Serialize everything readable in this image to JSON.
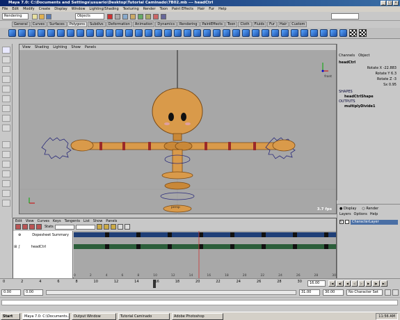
{
  "window": {
    "title": "Maya 7.0: C:\\Documents and Settings\\usuario\\Desktop\\Tutorial Caminado\\7B02.mb  ---  headCtrl"
  },
  "menu": [
    "File",
    "Edit",
    "Modify",
    "Create",
    "Display",
    "Window",
    "Lighting/Shading",
    "Texturing",
    "Render",
    "Toon",
    "Paint Effects",
    "Hair",
    "Fur",
    "Help"
  ],
  "statusline": {
    "mode": "Rendering",
    "selection_mode": "Objects"
  },
  "shelf_tabs": [
    "General",
    "Curves",
    "Surfaces",
    "Polygons",
    "Subdivs",
    "Deformation",
    "Animation",
    "Dynamics",
    "Rendering",
    "PaintEffects",
    "Toon",
    "Cloth",
    "Fluids",
    "Fur",
    "Hair",
    "Custom"
  ],
  "shelf_active": "Polygons",
  "viewport": {
    "menu": [
      "View",
      "Shading",
      "Lighting",
      "Show",
      "Panels"
    ],
    "fps": "3.7 fps",
    "view_cube": "front",
    "label": "persp"
  },
  "channel_box": {
    "header": [
      "Channels",
      "Object"
    ],
    "object": "headCtrl",
    "attributes": [
      {
        "name": "Rotate X",
        "value": "-22.883"
      },
      {
        "name": "Rotate Y",
        "value": "6.3"
      },
      {
        "name": "Rotate Z",
        "value": "-3"
      },
      {
        "name": "Sx",
        "value": "0.95"
      }
    ],
    "shapes_label": "SHAPES",
    "shape": "headCtrlShape",
    "outputs_label": "OUTPUTS",
    "output": "multiplyDivide1"
  },
  "layer_panel": {
    "display_label": "Display",
    "render_label": "Render",
    "menu": [
      "Layers",
      "Options",
      "Help"
    ],
    "layer": "CharacterLayer"
  },
  "dopesheet": {
    "menu": [
      "Edit",
      "View",
      "Curves",
      "Keys",
      "Tangents",
      "List",
      "Show",
      "Panels"
    ],
    "stats_label": "Stats",
    "rows": [
      "Dopesheet Summary",
      "headCtrl"
    ],
    "ruler": [
      "0",
      "2",
      "4",
      "6",
      "8",
      "10",
      "12",
      "14",
      "16",
      "18",
      "20",
      "22",
      "24",
      "26",
      "28",
      "30"
    ]
  },
  "timeline": {
    "ticks": [
      "0",
      "2",
      "4",
      "6",
      "8",
      "10",
      "12",
      "14",
      "16",
      "18",
      "20",
      "22",
      "24",
      "26",
      "28",
      "30"
    ],
    "current": "16.00",
    "range_start": "0.00",
    "range_start_inner": "0.00",
    "range_end_inner": "31.00",
    "range_end": "30.00",
    "character_set": "No Character Set"
  },
  "taskbar": {
    "start": "Start",
    "items": [
      "Maya 7.0: C:\\Documents...",
      "Output Window",
      "Tutorial Caminado",
      "Adobe Photoshop"
    ],
    "clock": "11:56 AM"
  },
  "colors": {
    "body": "#d99a4a",
    "body_dark": "#b8762c",
    "timeline_key": "#2b5e3a",
    "timeline_summary": "#1f3f77",
    "highlight": "#4a6fa5"
  }
}
